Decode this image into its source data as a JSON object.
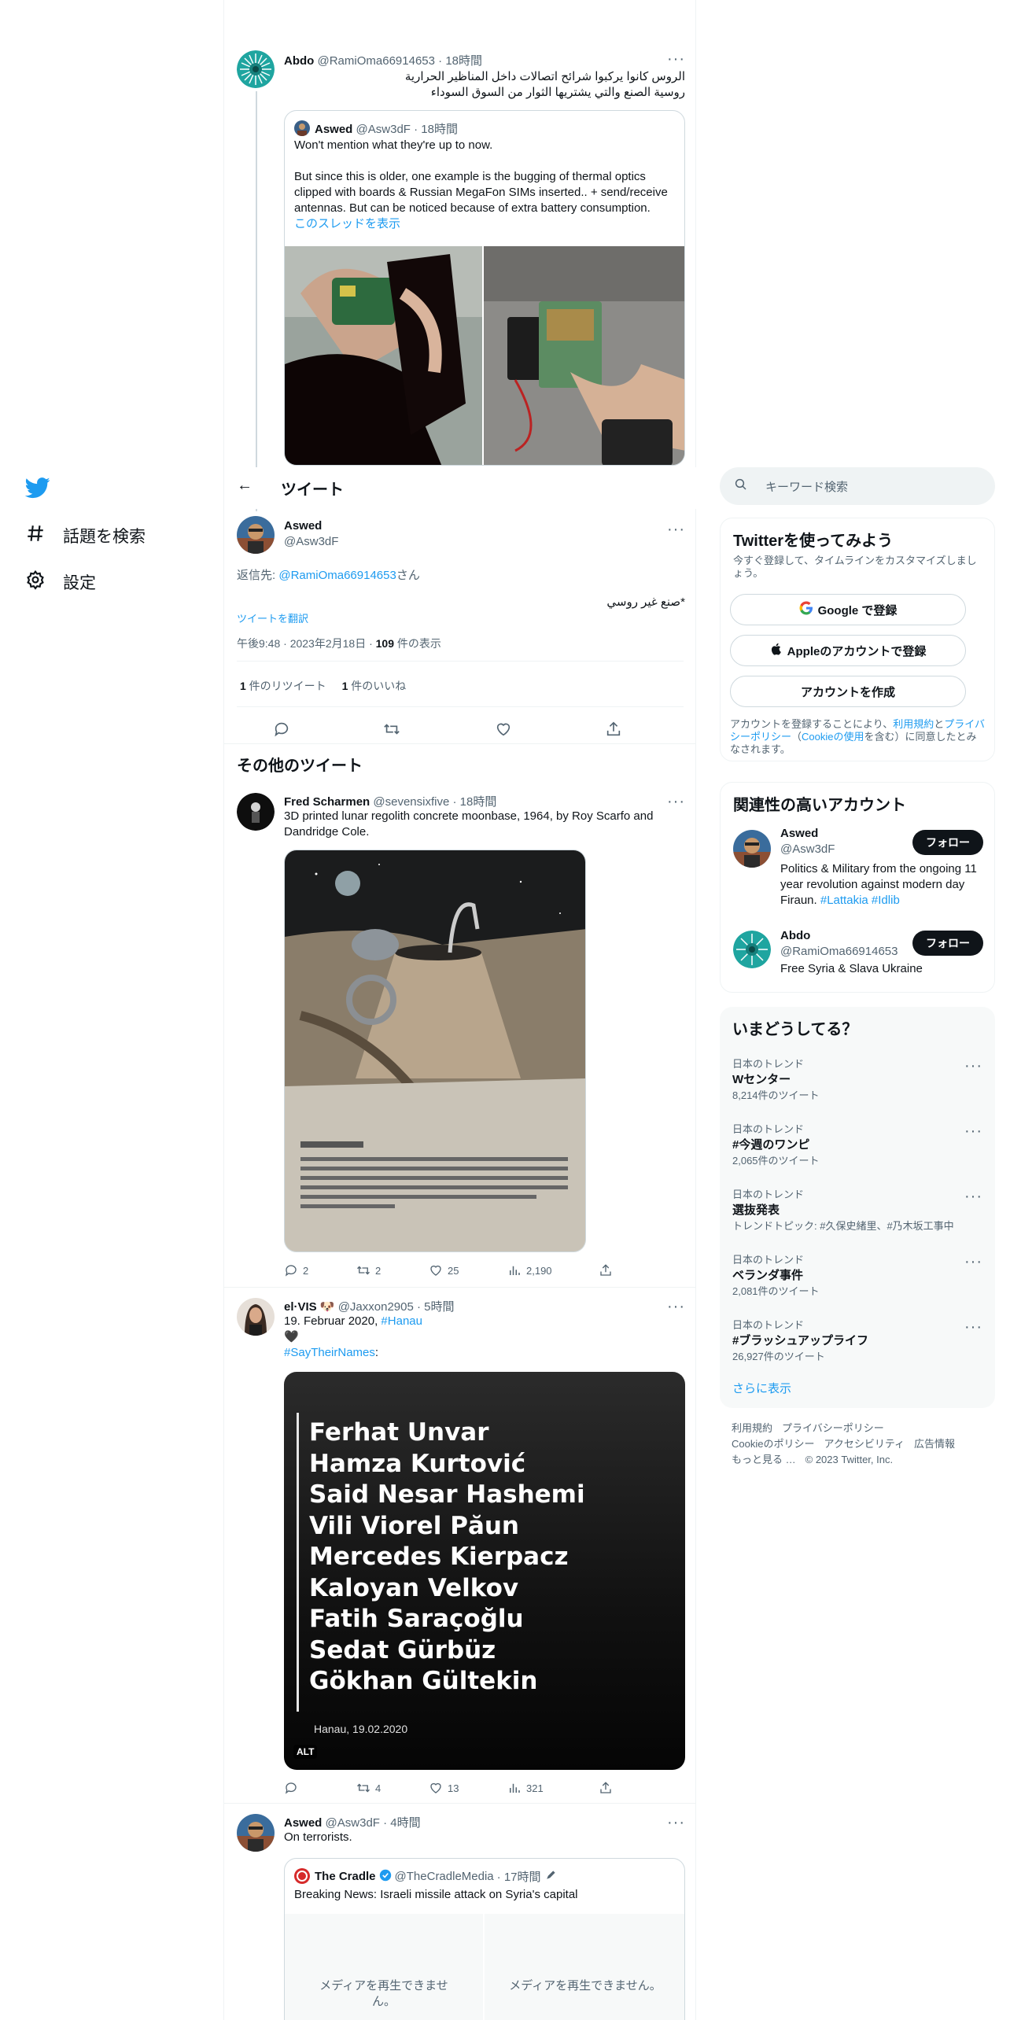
{
  "nav": {
    "explore_label": "話題を検索",
    "settings_label": "設定"
  },
  "thread_tweet": {
    "name": "Abdo",
    "handle": "@RamiOma66914653",
    "time": "· 18時間",
    "text_line1": "الروس كانوا يركبوا شرائح اتصالات داخل المناظير الحرارية",
    "text_line2": "روسية الصنع والتي يشتريها الثوار من السوق السوداء",
    "quote": {
      "name": "Aswed",
      "handle": "@Asw3dF",
      "time": "· 18時間",
      "line1": "Won't mention what they're up to now.",
      "line2": "But since this is older, one example is the bugging of thermal optics clipped with boards & Russian MegaFon SIMs inserted.. + send/receive antennas. But can be noticed because of extra battery consumption.",
      "show_thread": "このスレッドを表示"
    }
  },
  "header": {
    "back_label": "←",
    "title": "ツイート"
  },
  "main_tweet": {
    "name": "Aswed",
    "handle": "@Asw3dF",
    "reply_prefix": "返信先: ",
    "reply_handle": "@RamiOma66914653",
    "reply_suffix": "さん",
    "text": "*صنع غير روسي",
    "translate": "ツイートを翻訳",
    "timestamp": "午後9:48 · 2023年2月18日 · ",
    "views_count": "109",
    "views_label": " 件の表示",
    "retweets_count": "1",
    "retweets_label": " 件のリツイート",
    "likes_count": "1",
    "likes_label": " 件のいいね"
  },
  "more_tweets_heading": "その他のツイート",
  "tweet_fred": {
    "name": "Fred Scharmen",
    "handle": "@sevensixfive",
    "time": "· 18時間",
    "text": "3D printed lunar regolith concrete moonbase, 1964, by Roy Scarfo and Dandridge Cole.",
    "image_caption_title": "Lunar Igloo",
    "image_caption_text": "A lunar igloo is shown under construction at the north lunar pole. It is assumed that lunar surface minerals have been found which can be pulverized, processed, and made into a type of concrete. The machine in the foreground continuously deposits the concrete in a rising spiral motion. Such structures may form the shelters for the personnel of early lunar bases.",
    "replies": "2",
    "retweets": "2",
    "likes": "25",
    "views": "2,190"
  },
  "tweet_elvis": {
    "name": "el·VIS 🐶",
    "handle": "@Jaxxon2905",
    "time": "· 5時間",
    "text_date": "19. Februar 2020, ",
    "hashtag1": "#Hanau",
    "heart": "🖤",
    "hashtag2": "#SayTheirNames",
    "colon": ":",
    "names": [
      "Ferhat Unvar",
      "Hamza Kurtović",
      "Said Nesar Hashemi",
      "Vili Viorel Păun",
      "Mercedes Kierpacz",
      "Kaloyan Velkov",
      "Fatih Saraçoğlu",
      "Sedat Gürbüz",
      "Gökhan Gültekin"
    ],
    "image_footer": "Hanau, 19.02.2020",
    "alt_badge": "ALT",
    "replies": "",
    "retweets": "4",
    "likes": "13",
    "views": "321"
  },
  "tweet_aswed2": {
    "name": "Aswed",
    "handle": "@Asw3dF",
    "time": "· 4時間",
    "text": "On terrorists.",
    "quote": {
      "name": "The Cradle",
      "handle": "@TheCradleMedia",
      "time": "· 17時間",
      "text": "Breaking News: Israeli missile attack on Syria's capital",
      "media_error": "メディアを再生できません。"
    }
  },
  "sidebar": {
    "search_placeholder": "キーワード検索",
    "signup": {
      "title": "Twitterを使ってみよう",
      "subtitle": "今すぐ登録して、タイムラインをカスタマイズしましょう。",
      "google": "Google で登録",
      "apple": "Appleのアカウントで登録",
      "create": "アカウントを作成",
      "legal_1": "アカウントを登録することにより、",
      "legal_terms": "利用規約",
      "legal_2": "と",
      "legal_privacy": "プライバシーポリシー",
      "legal_3": "（",
      "legal_cookie": "Cookieの使用",
      "legal_4": "を含む）に同意したとみなされます。"
    },
    "related": {
      "title": "関連性の高いアカウント",
      "accounts": [
        {
          "name": "Aswed",
          "handle": "@Asw3dF",
          "bio": "Politics & Military from the ongoing 11 year revolution against modern day Firaun. ",
          "tag1": "#Lattakia",
          "tag2": "#Idlib",
          "follow": "フォロー"
        },
        {
          "name": "Abdo",
          "handle": "@RamiOma66914653",
          "bio": "Free Syria & Slava Ukraine",
          "follow": "フォロー"
        }
      ]
    },
    "trends": {
      "title": "いまどうしてる？",
      "items": [
        {
          "context": "日本のトレンド",
          "name": "Wセンター",
          "count": "8,214件のツイート"
        },
        {
          "context": "日本のトレンド",
          "name": "#今週のワンピ",
          "count": "2,065件のツイート"
        },
        {
          "context": "日本のトレンド",
          "name": "選抜発表",
          "count": "トレンドトピック: #久保史緒里、#乃木坂工事中"
        },
        {
          "context": "日本のトレンド",
          "name": "ベランダ事件",
          "count": "2,081件のツイート"
        },
        {
          "context": "日本のトレンド",
          "name": "#ブラッシュアップライフ",
          "count": "26,927件のツイート"
        }
      ],
      "show_more": "さらに表示"
    },
    "footer": {
      "terms": "利用規約",
      "privacy": "プライバシーポリシー",
      "cookies": "Cookieのポリシー",
      "accessibility": "アクセシビリティ",
      "ads": "広告情報",
      "more": "もっと見る …",
      "copyright": "© 2023 Twitter, Inc."
    }
  },
  "colors": {
    "accent": "#1d9bf0",
    "text": "#0f1419",
    "muted": "#536471",
    "border": "#eff3f4"
  }
}
